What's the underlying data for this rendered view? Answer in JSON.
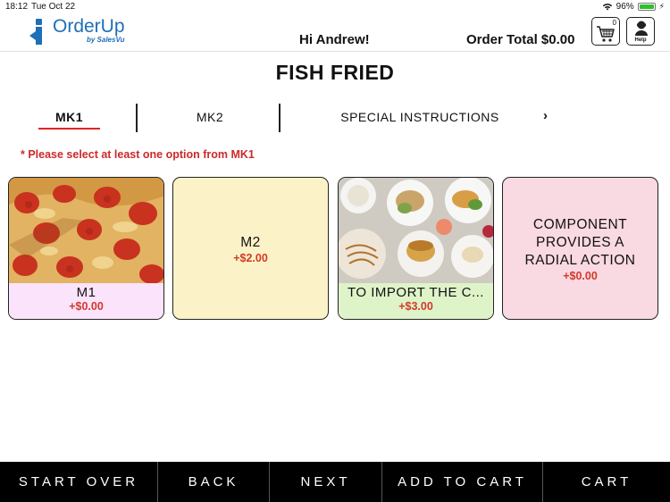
{
  "status_bar": {
    "time": "18:12",
    "date": "Tue Oct 22",
    "battery": "96%",
    "icons": [
      "wifi-icon",
      "battery-icon",
      "charging-bolt-icon"
    ]
  },
  "header": {
    "logo_name": "OrderUp",
    "logo_sub": "by SalesVu",
    "greeting": "Hi Andrew!",
    "order_total": "Order Total $0.00",
    "cart_count": "0",
    "cart_icon": "shopping-cart-icon",
    "help_label": "Help",
    "help_icon": "help-person-icon"
  },
  "item_title": "FISH FRIED",
  "tabs": [
    {
      "label": "MK1",
      "active": true
    },
    {
      "label": "MK2",
      "active": false
    },
    {
      "label": "SPECIAL INSTRUCTIONS",
      "active": false
    }
  ],
  "tabs_next": "›",
  "warning": "* Please select at least one option from MK1",
  "options": [
    {
      "name": "M1",
      "price": "+$0.00",
      "image": "pizza-image"
    },
    {
      "name": "M2",
      "price": "+$2.00"
    },
    {
      "name": "TO IMPORT THE C...",
      "price": "+$3.00",
      "image": "food-platter-image"
    },
    {
      "name": "COMPONENT PROVIDES A RADIAL ACTION",
      "price": "+$0.00"
    }
  ],
  "colors": {
    "brand_blue": "#1e6fb8",
    "accent_red": "#e02424",
    "price_red": "#d23a2a",
    "card_m1_bg": "#fbe3fb",
    "card_m2_bg": "#fbf3c7",
    "card_import_bg": "#dff3c9",
    "card_comp_bg": "#f9d9e2"
  },
  "bottom_bar": {
    "start_over": "START OVER",
    "back": "BACK",
    "next": "NEXT",
    "add_to_cart": "ADD TO CART",
    "cart": "CART"
  }
}
